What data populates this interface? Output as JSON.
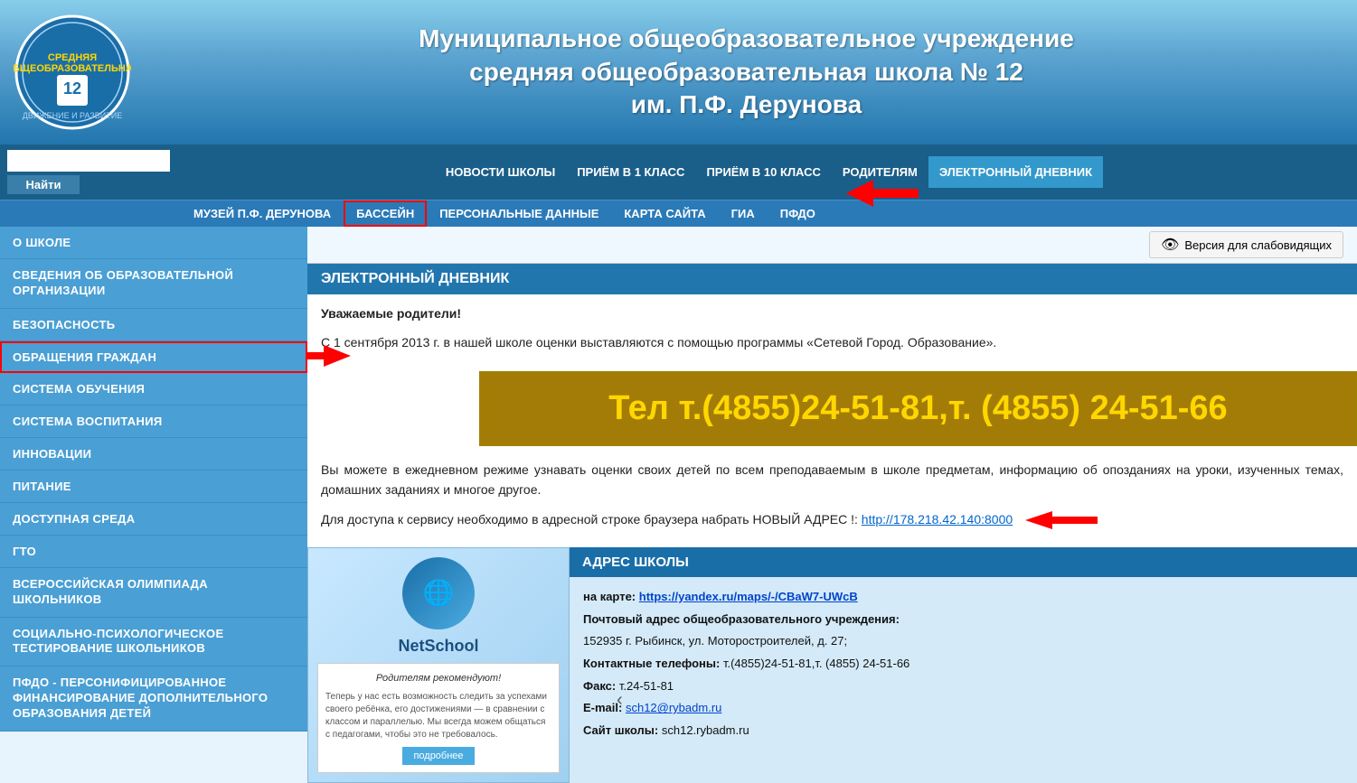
{
  "header": {
    "title_line1": "Муниципальное общеобразовательное  учреждение",
    "title_line2": "средняя общеобразовательная школа № 12",
    "title_line3": "им. П.Ф. Дерунова"
  },
  "nav": {
    "search_placeholder": "",
    "search_btn": "Найти",
    "top_links": [
      {
        "label": "НОВОСТИ ШКОЛЫ",
        "active": false
      },
      {
        "label": "ПРИЁМ В 1 КЛАСС",
        "active": false
      },
      {
        "label": "ПРИЁМ В 10 КЛАСС",
        "active": false
      },
      {
        "label": "РОДИТЕЛЯМ",
        "active": false
      },
      {
        "label": "ЭЛЕКТРОННЫЙ ДНЕВНИК",
        "active": true
      }
    ],
    "bottom_links": [
      {
        "label": "МУЗЕЙ П.Ф. ДЕРУНОВА",
        "highlighted": false
      },
      {
        "label": "БАССЕЙН",
        "highlighted": true
      },
      {
        "label": "ПЕРСОНАЛЬНЫЕ ДАННЫЕ",
        "highlighted": false
      },
      {
        "label": "КАРТА САЙТА",
        "highlighted": false
      },
      {
        "label": "ГИА",
        "highlighted": false
      },
      {
        "label": "ПФДО",
        "highlighted": false
      }
    ]
  },
  "sidebar": {
    "items": [
      {
        "label": "О ШКОЛЕ",
        "highlighted": false
      },
      {
        "label": "СВЕДЕНИЯ ОБ ОБРАЗОВАТЕЛЬНОЙ ОРГАНИЗАЦИИ",
        "highlighted": false
      },
      {
        "label": "БЕЗОПАСНОСТЬ",
        "highlighted": false
      },
      {
        "label": "ОБРАЩЕНИЯ ГРАЖДАН",
        "highlighted": true
      },
      {
        "label": "СИСТЕМА ОБУЧЕНИЯ",
        "highlighted": false
      },
      {
        "label": "СИСТЕМА ВОСПИТАНИЯ",
        "highlighted": false
      },
      {
        "label": "ИННОВАЦИИ",
        "highlighted": false
      },
      {
        "label": "ПИТАНИЕ",
        "highlighted": false
      },
      {
        "label": "ДОСТУПНАЯ СРЕДА",
        "highlighted": false
      },
      {
        "label": "ГТО",
        "highlighted": false
      },
      {
        "label": "ВСЕРОССИЙСКАЯ ОЛИМПИАДА ШКОЛЬНИКОВ",
        "highlighted": false
      },
      {
        "label": "СОЦИАЛЬНО-ПСИХОЛОГИЧЕСКОЕ ТЕСТИРОВАНИЕ ШКОЛЬНИКОВ",
        "highlighted": false
      },
      {
        "label": "ПФДО - ПЕРСОНИФИЦИРОВАННОЕ ФИНАНСИРОВАНИЕ ДОПОЛНИТЕЛЬНОГО ОБРАЗОВАНИЯ ДЕТЕЙ",
        "highlighted": false
      }
    ]
  },
  "content": {
    "visibility_btn": "Версия для слабовидящих",
    "section_title": "ЭЛЕКТРОННЫЙ ДНЕВНИК",
    "phone_banner": "Тел т.(4855)24-51-81,т. (4855) 24-51-66",
    "intro_text": "Уважаемые родители!",
    "para1": "С 1 сентября 2013 г. в нашей школе оценки выставляются с помощью программы «Сетевой Город. Образование».",
    "para2": "Вы можете в ежедневном режиме узнавать оценки своих детей по всем преподаваемым в школе предметам, информацию об опозданиях на уроки, изученных темах, домашних заданиях и многое другое.",
    "para3_start": "Для доступа к сервису необходимо в адресной строке браузера набрать НОВЫЙ АДРЕС !:",
    "link_url": "http://178.218.42.140:8000",
    "link_text": "http://178.218.42.140:8000"
  },
  "address": {
    "title": "АДРЕС ШКОЛЫ",
    "map_label": "на карте:",
    "map_url": "https://yandex.ru/maps/-/CBaW7-UWcB",
    "map_link_text": "https://yandex.ru/maps/-/CBaW7-UWcB",
    "postal_label": "Почтовый адрес общеобразовательного учреждения:",
    "postal": "152935 г. Рыбинск, ул. Моторостроителей, д. 27;",
    "phones_label": "Контактные телефоны:",
    "phones": "т.(4855)24-51-81,т. (4855) 24-51-66",
    "fax_label": "Факс:",
    "fax": "т.24-51-81",
    "email_label": "E-mail:",
    "email_text": "sch12@rybadm.ru",
    "site_label": "Сайт школы:",
    "site": "sch12.rybadm.ru"
  }
}
